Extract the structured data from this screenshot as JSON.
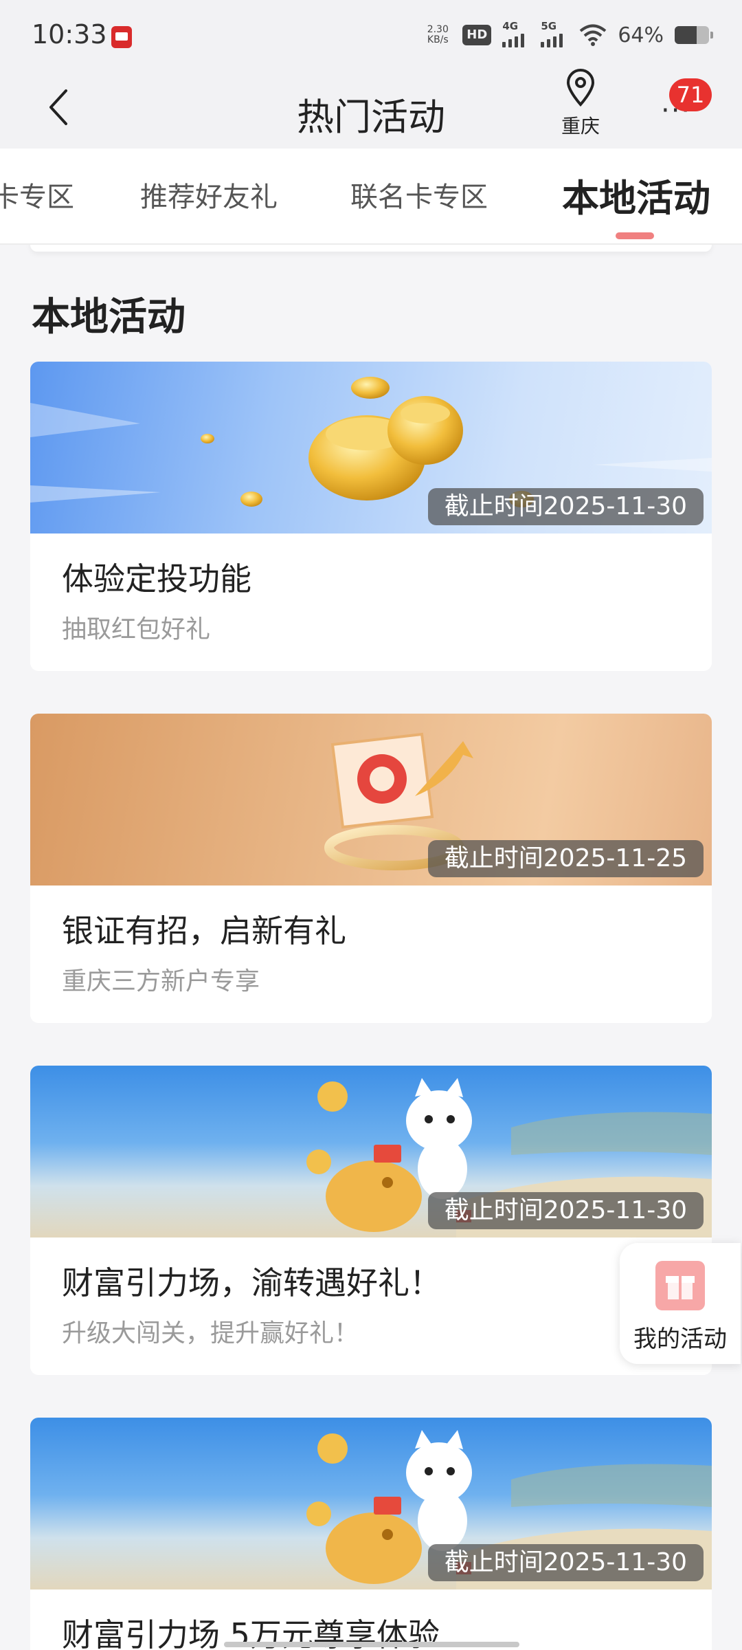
{
  "status_bar": {
    "time": "10:33",
    "net_speed_value": "2.30",
    "net_speed_unit": "KB/s",
    "hd_badge": "HD",
    "signal1_label": "4G",
    "signal2_label": "5G",
    "battery_percent": "64%",
    "battery_level": 0.64,
    "icons": [
      "app-notification-icon",
      "hd-icon",
      "signal-icon",
      "wifi-icon",
      "battery-icon"
    ]
  },
  "header": {
    "title": "热门活动",
    "location_label": "重庆",
    "notification_count": "71",
    "icons": [
      "back-arrow-icon",
      "location-pin-icon",
      "more-dots-icon"
    ]
  },
  "tabs": [
    {
      "label": "卡专区",
      "active": false
    },
    {
      "label": "推荐好友礼",
      "active": false
    },
    {
      "label": "联名卡专区",
      "active": false
    },
    {
      "label": "本地活动",
      "active": true
    }
  ],
  "section_title": "本地活动",
  "cards": [
    {
      "title": "体验定投功能",
      "subtitle": "抽取红包好礼",
      "deadline": "截止时间2025-11-30",
      "banner": "gold-ingots"
    },
    {
      "title": "银证有招，启新有礼",
      "subtitle": "重庆三方新户专享",
      "deadline": "截止时间2025-11-25",
      "banner": "card-on-ring"
    },
    {
      "title": "财富引力场，渝转遇好礼！",
      "subtitle": "升级大闯关，提升赢好礼！",
      "deadline": "截止时间2025-11-30",
      "banner": "cat-mascot-piggy"
    },
    {
      "title": "财富引力场 5万元尊享体验",
      "subtitle": "",
      "deadline": "截止时间2025-11-30",
      "banner": "cat-mascot-piggy"
    }
  ],
  "floating": {
    "label": "我的活动",
    "icon": "gift-icon"
  },
  "colors": {
    "accent": "#e8322f",
    "tab_indicator": "#f08080",
    "background": "#f5f5f7"
  }
}
